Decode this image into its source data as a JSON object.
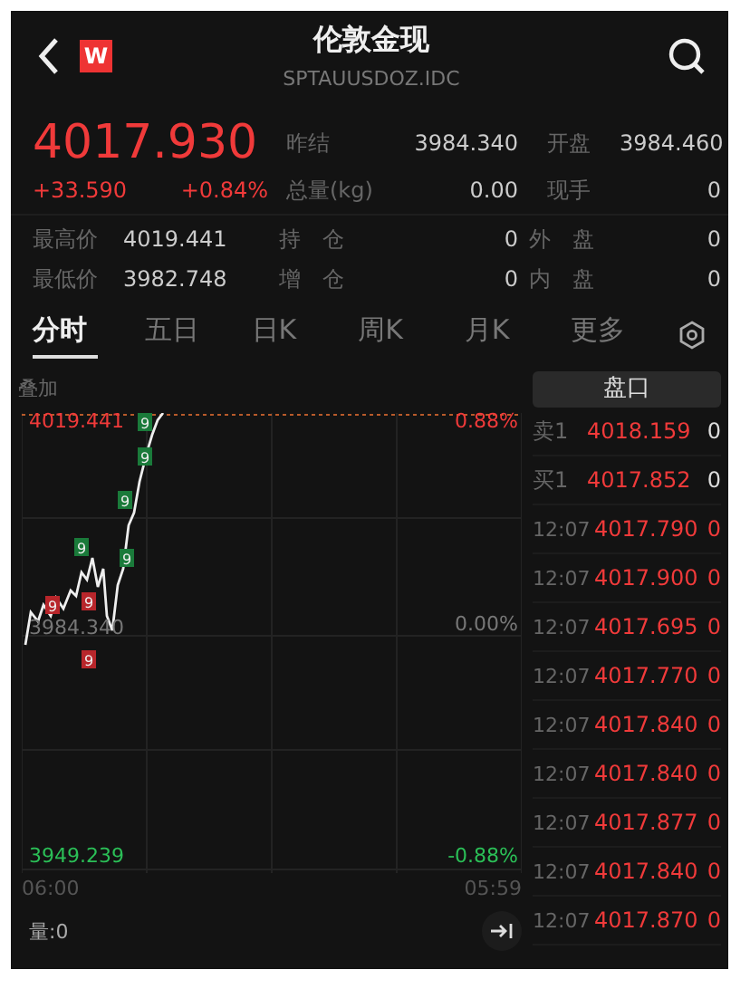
{
  "header": {
    "title": "伦敦金现",
    "code": "SPTAUUSDOZ.IDC",
    "badge": "W"
  },
  "quote": {
    "price": "4017.930",
    "change": "+33.590",
    "percent": "+0.84%"
  },
  "stats": [
    {
      "label": "昨结",
      "value": "3984.340"
    },
    {
      "label": "开盘",
      "value": "3984.460"
    },
    {
      "label": "总量(kg)",
      "value": "0.00"
    },
    {
      "label": "现手",
      "value": "0"
    }
  ],
  "details": [
    {
      "label": "最高价",
      "value": "4019.441"
    },
    {
      "label": "持　仓",
      "value": "0"
    },
    {
      "label": "外　盘",
      "value": "0"
    },
    {
      "label": "最低价",
      "value": "3982.748"
    },
    {
      "label": "增　仓",
      "value": "0"
    },
    {
      "label": "内　盘",
      "value": "0"
    }
  ],
  "tabs": [
    {
      "label": "分时",
      "selected": true
    },
    {
      "label": "五日",
      "selected": false
    },
    {
      "label": "日K",
      "selected": false
    },
    {
      "label": "周K",
      "selected": false
    },
    {
      "label": "月K",
      "selected": false
    },
    {
      "label": "更多",
      "selected": false
    }
  ],
  "chart": {
    "overlay": "叠加",
    "high": "4019.441",
    "high_pct": "0.88%",
    "base": "3984.340",
    "base_pct": "0.00%",
    "low": "3949.239",
    "low_pct": "-0.88%",
    "start_time": "06:00",
    "end_time": "05:59",
    "volume": "量:0",
    "markers": [
      {
        "label": "9",
        "kind": "rise"
      },
      {
        "label": "9",
        "kind": "rise"
      },
      {
        "label": "9",
        "kind": "rise"
      },
      {
        "label": "9",
        "kind": "rise"
      },
      {
        "label": "9",
        "kind": "rise"
      },
      {
        "label": "9",
        "kind": "fall"
      },
      {
        "label": "9",
        "kind": "fall"
      },
      {
        "label": "9",
        "kind": "fall"
      }
    ]
  },
  "book": {
    "title": "盘口",
    "levels": [
      {
        "label": "卖1",
        "price": "4018.159",
        "volume": "0"
      },
      {
        "label": "买1",
        "price": "4017.852",
        "volume": "0"
      }
    ],
    "trades": [
      {
        "time": "12:07",
        "price": "4017.790",
        "volume": "0"
      },
      {
        "time": "12:07",
        "price": "4017.900",
        "volume": "0"
      },
      {
        "time": "12:07",
        "price": "4017.695",
        "volume": "0"
      },
      {
        "time": "12:07",
        "price": "4017.770",
        "volume": "0"
      },
      {
        "time": "12:07",
        "price": "4017.840",
        "volume": "0"
      },
      {
        "time": "12:07",
        "price": "4017.840",
        "volume": "0"
      },
      {
        "time": "12:07",
        "price": "4017.877",
        "volume": "0"
      },
      {
        "time": "12:07",
        "price": "4017.840",
        "volume": "0"
      },
      {
        "time": "12:07",
        "price": "4017.870",
        "volume": "0"
      }
    ]
  }
}
